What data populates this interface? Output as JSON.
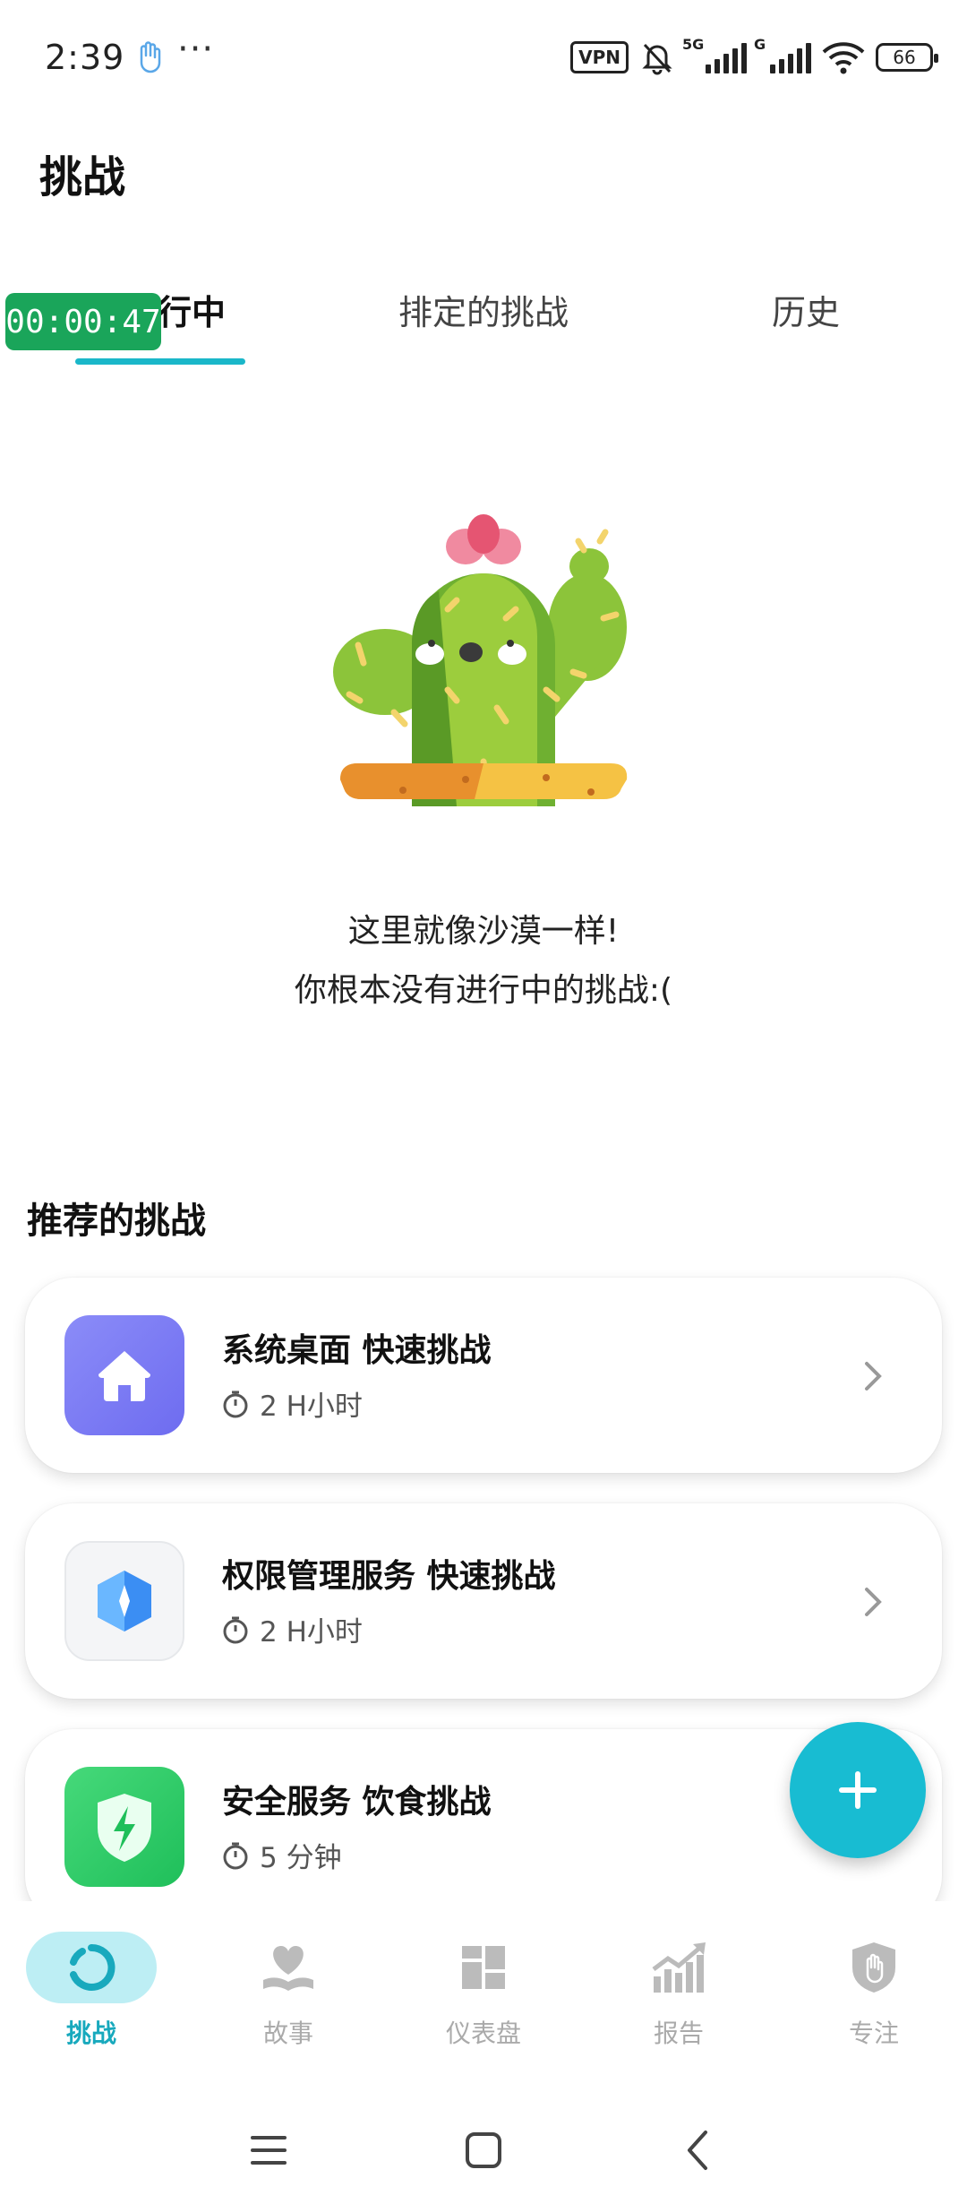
{
  "status_bar": {
    "time": "2:39",
    "more": "···",
    "vpn": "VPN",
    "net1": "5G",
    "net2": "G",
    "battery": "66",
    "icons": [
      "hand-icon",
      "vpn-icon",
      "mute-bell-icon",
      "signal-icon",
      "signal-icon",
      "wifi-icon",
      "battery-icon"
    ]
  },
  "header": {
    "title": "挑战"
  },
  "tabs": [
    {
      "label": "进行中",
      "active": true
    },
    {
      "label": "排定的挑战",
      "active": false
    },
    {
      "label": "历史",
      "active": false
    }
  ],
  "timer_overlay": "00:00:47",
  "empty_state": {
    "line1": "这里就像沙漠一样!",
    "line2": "你根本没有进行中的挑战:("
  },
  "recommended": {
    "title": "推荐的挑战",
    "items": [
      {
        "title": "系统桌面 快速挑战",
        "duration": "2 H小时",
        "icon": "home-icon",
        "color": "#7c7cf6"
      },
      {
        "title": "权限管理服务 快速挑战",
        "duration": "2 H小时",
        "icon": "shield-crystal-icon",
        "color": "#3f8ff5"
      },
      {
        "title": "安全服务 饮食挑战",
        "duration": "5 分钟",
        "icon": "security-shield-icon",
        "color": "#2fcf6a"
      }
    ]
  },
  "fab": {
    "label": "+"
  },
  "bottom_nav": [
    {
      "label": "挑战",
      "icon": "challenge-ring-icon",
      "active": true
    },
    {
      "label": "故事",
      "icon": "heart-book-icon",
      "active": false
    },
    {
      "label": "仪表盘",
      "icon": "dashboard-icon",
      "active": false
    },
    {
      "label": "报告",
      "icon": "report-chart-icon",
      "active": false
    },
    {
      "label": "专注",
      "icon": "focus-shield-icon",
      "active": false
    }
  ],
  "colors": {
    "accent": "#1ab7c9",
    "timer": "#1aa55a"
  }
}
